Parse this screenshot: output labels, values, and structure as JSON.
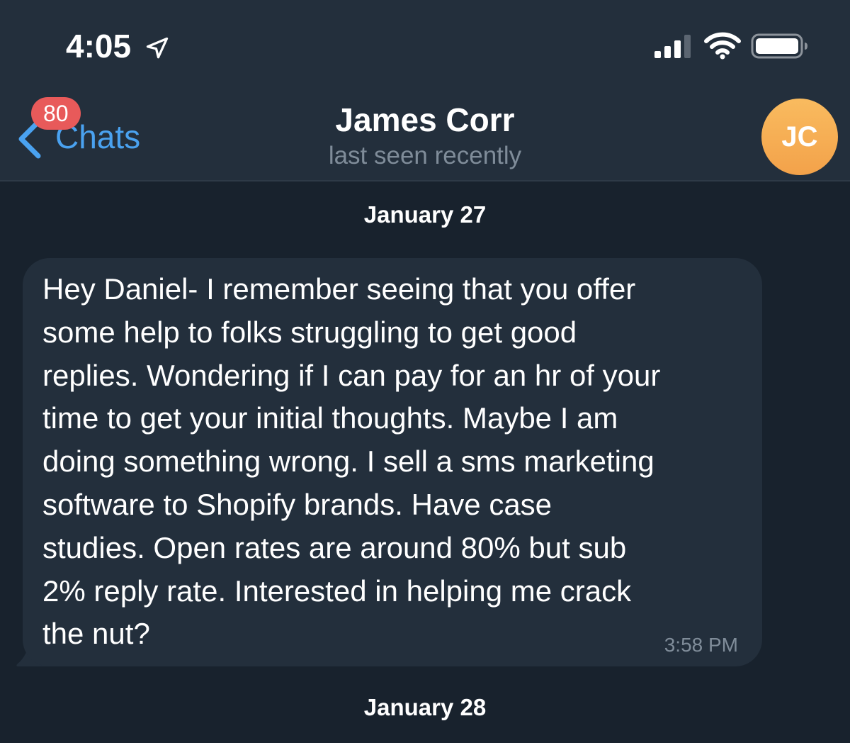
{
  "status_bar": {
    "time": "4:05"
  },
  "header": {
    "back_label": "Chats",
    "unread_count": "80",
    "title": "James Corr",
    "subtitle": "last seen recently",
    "avatar_initials": "JC"
  },
  "messages": [
    {
      "date": "January 27",
      "text": "Hey Daniel- I remember seeing that you offer\nsome help to folks struggling to get good\nreplies. Wondering if I can pay for an hr of your\ntime to get your initial thoughts. Maybe I am\ndoing something wrong. I sell a sms marketing\nsoftware to Shopify brands. Have case\nstudies. Open rates are around 80% but sub\n2% reply rate. Interested in helping me crack\nthe nut?",
      "time": "3:58 PM"
    }
  ],
  "next_date": "January 28",
  "colors": {
    "background": "#18222d",
    "bubble": "#232f3c",
    "accent": "#4aa2f0",
    "badge": "#e85a5a",
    "muted": "#7f8c99",
    "avatar": "#f5ab50"
  },
  "icons": [
    "location-arrow-icon",
    "cellular-signal-icon",
    "wifi-icon",
    "battery-icon",
    "chevron-left-icon"
  ]
}
